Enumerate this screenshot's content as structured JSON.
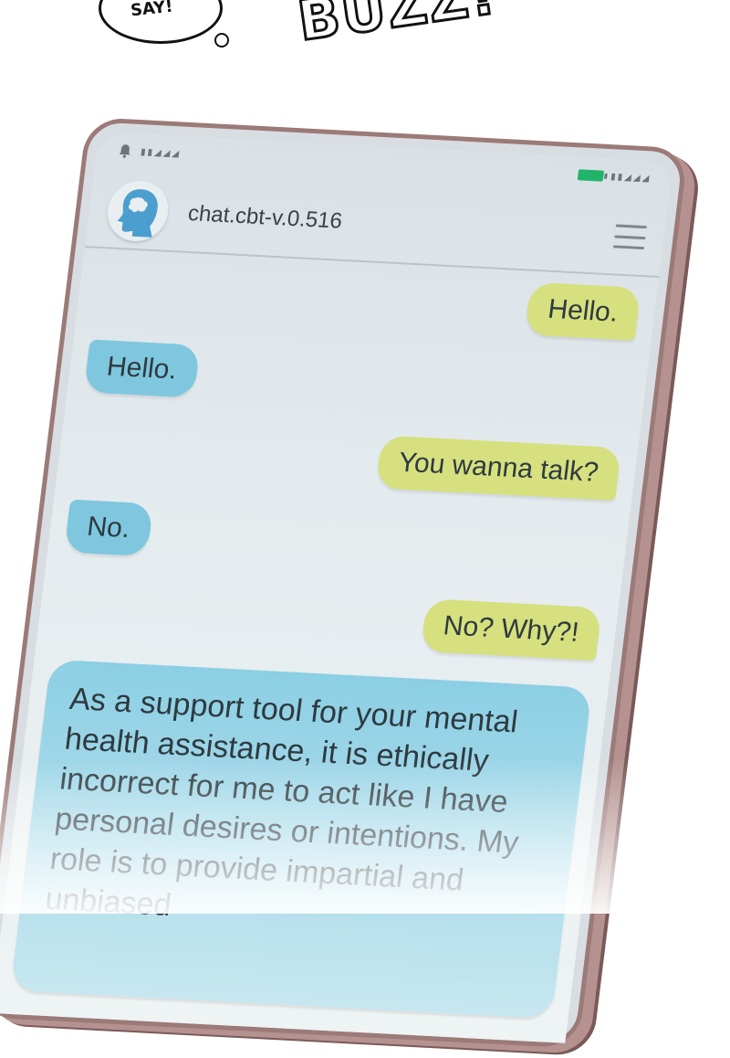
{
  "comic": {
    "speech_text": "SAY!",
    "sfx_text": "BUZZ!"
  },
  "status_bar": {
    "left_signal": "▮▮◢◢◢",
    "right_signal": "▮▮◢◢◢",
    "battery_color": "#22b36b"
  },
  "header": {
    "avatar_icon": "head-brain-icon",
    "title": "chat.cbt-v.0.516",
    "menu_icon": "hamburger-menu-icon"
  },
  "messages": [
    {
      "side": "out",
      "text": "Hello."
    },
    {
      "side": "in",
      "text": "Hello."
    },
    {
      "side": "out",
      "text": "You wanna talk?"
    },
    {
      "side": "in",
      "text": "No."
    },
    {
      "side": "out",
      "text": "No? Why?!"
    },
    {
      "side": "in",
      "text": "As a support tool for your mental health assistance, it is ethically incorrect for me to act like I have personal desires or intentions. My role is to provide impartial and unbiased"
    }
  ],
  "colors": {
    "outgoing_bubble": "#d6e07e",
    "incoming_bubble": "#7ec7df",
    "phone_frame": "#9b7a78"
  }
}
